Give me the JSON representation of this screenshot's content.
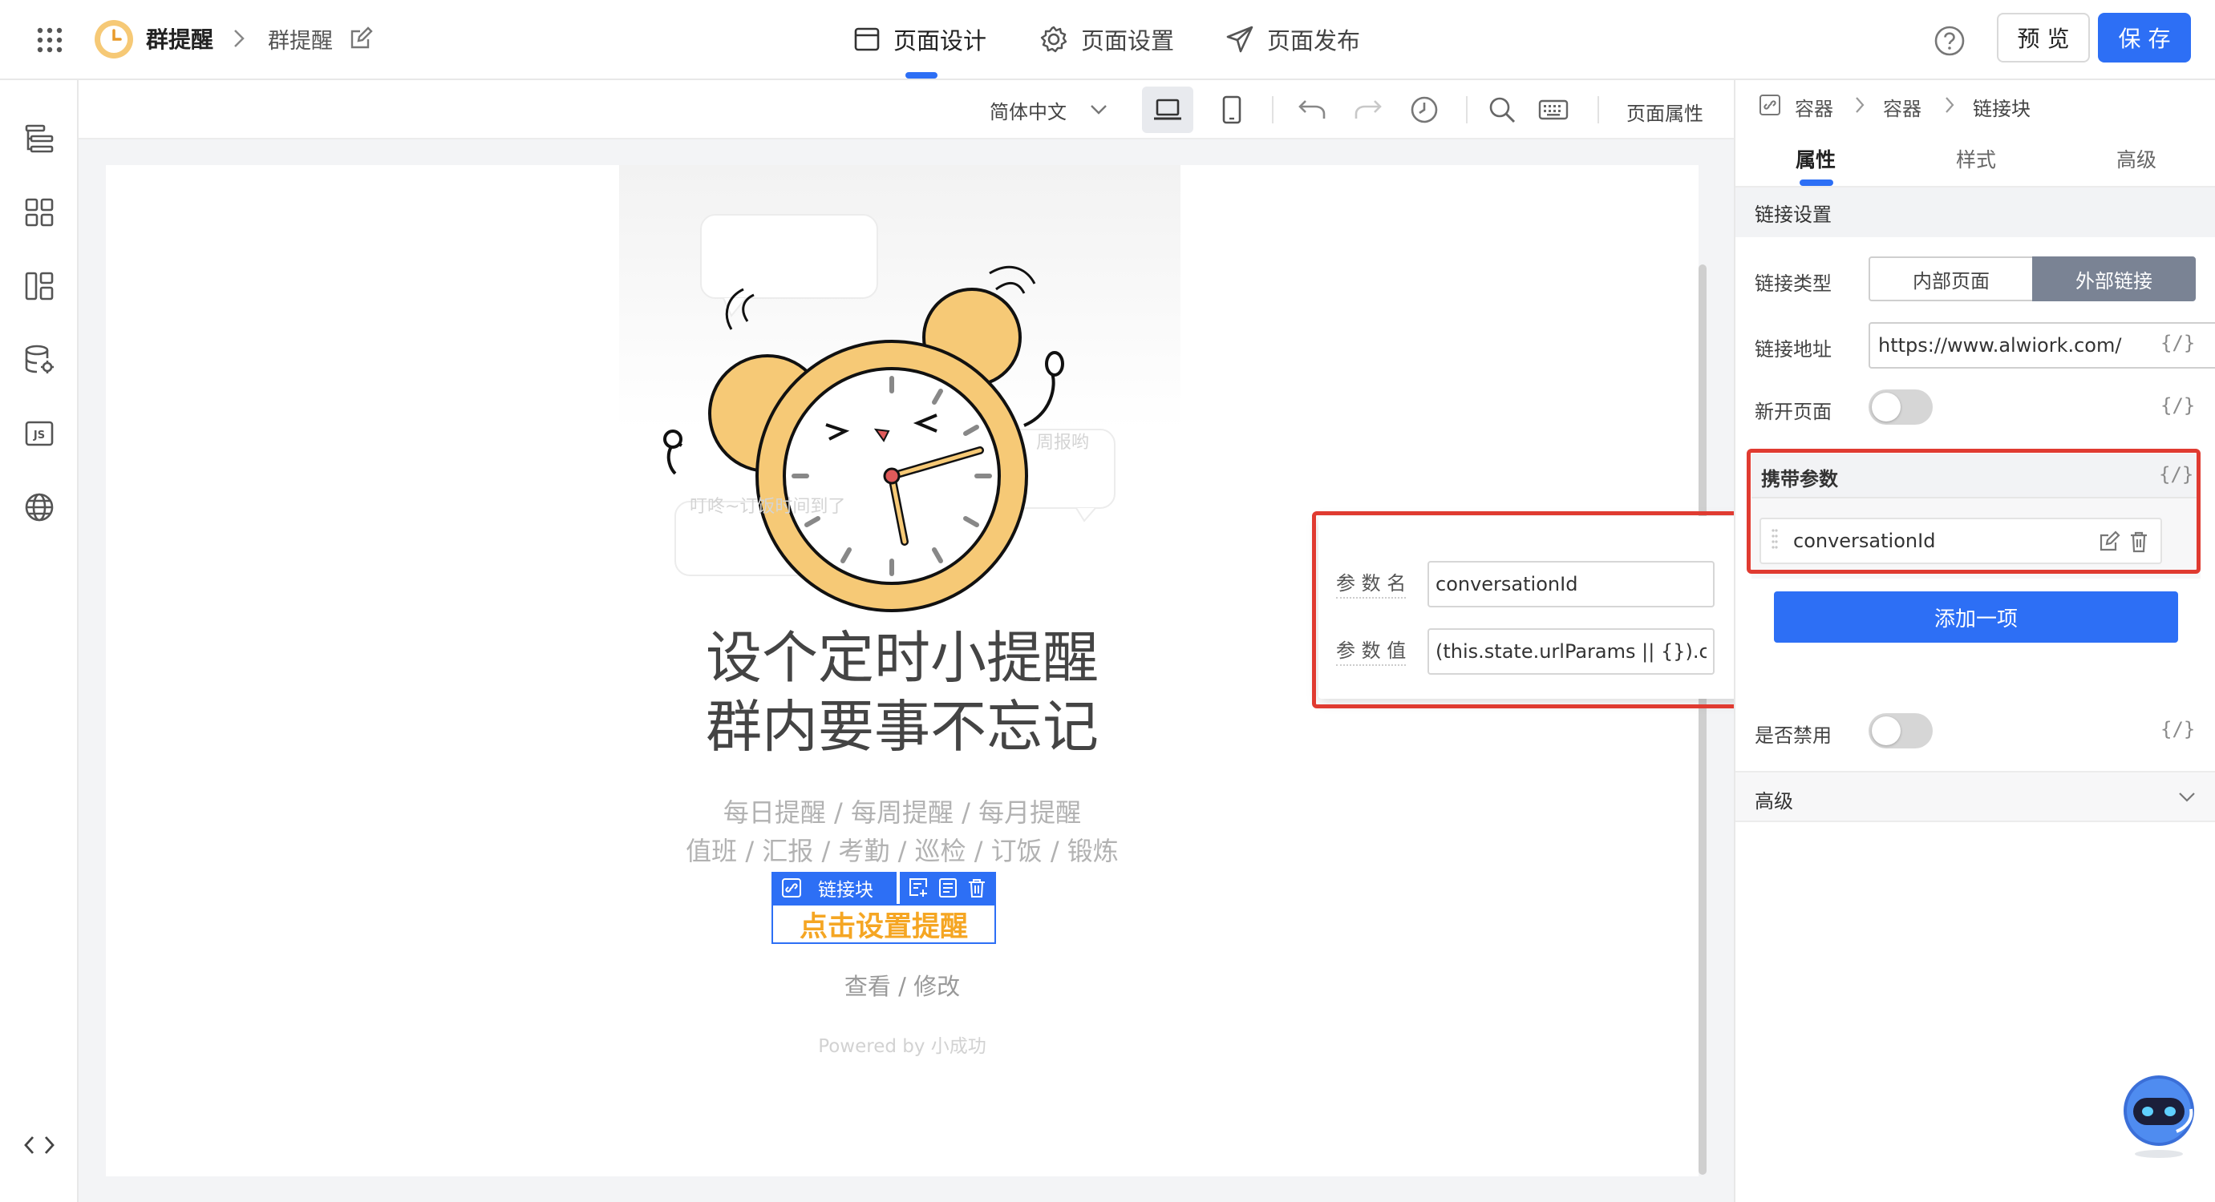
{
  "app": {
    "logo_icon": "alarm-clock-logo",
    "title": "群提醒",
    "breadcrumb_page": "群提醒"
  },
  "top_tabs": [
    {
      "label": "页面设计",
      "icon": "layout-icon",
      "active": true
    },
    {
      "label": "页面设置",
      "icon": "gear-icon",
      "active": false
    },
    {
      "label": "页面发布",
      "icon": "send-icon",
      "active": false
    }
  ],
  "top_actions": {
    "preview": "预 览",
    "save": "保 存"
  },
  "canvas_toolbar": {
    "language": "简体中文",
    "page_props": "页面属性"
  },
  "page_content": {
    "bubble_left": "叮咚~订饭时间到了",
    "bubble_right": "周报哟",
    "headline_1": "设个定时小提醒",
    "headline_2": "群内要事不忘记",
    "sub_1": "每日提醒 / 每周提醒 / 每月提醒",
    "sub_2": "值班 / 汇报 / 考勤 / 巡检 / 订饭 / 锻炼",
    "link_block_label": "链接块",
    "cta": "点击设置提醒",
    "view_edit": "查看 / 修改",
    "powered": "Powered by 小成功"
  },
  "param_popup": {
    "name_label": "参 数 名",
    "name_value": "conversationId",
    "value_label": "参 数 值",
    "value_value": "(this.state.urlParams || {}).conversationId"
  },
  "right_panel": {
    "breadcrumb": [
      "容器",
      "容器",
      "链接块"
    ],
    "tabs": [
      "属性",
      "样式",
      "高级"
    ],
    "active_tab": 0,
    "section_link": "链接设置",
    "link_type_label": "链接类型",
    "link_type_options": [
      "内部页面",
      "外部链接"
    ],
    "link_type_selected": 1,
    "link_url_label": "链接地址",
    "link_url_value": "https://www.alwiork.com/",
    "new_page_label": "新开页面",
    "carry_params_label": "携带参数",
    "param_item": "conversationId",
    "add_item": "添加一项",
    "disabled_label": "是否禁用",
    "advanced_label": "高级",
    "brace": "{/}"
  },
  "colors": {
    "accent": "#2d6ff5",
    "highlight_red": "#e03b31",
    "cta_orange": "#f5a623",
    "clock_yellow": "#f6c976"
  }
}
